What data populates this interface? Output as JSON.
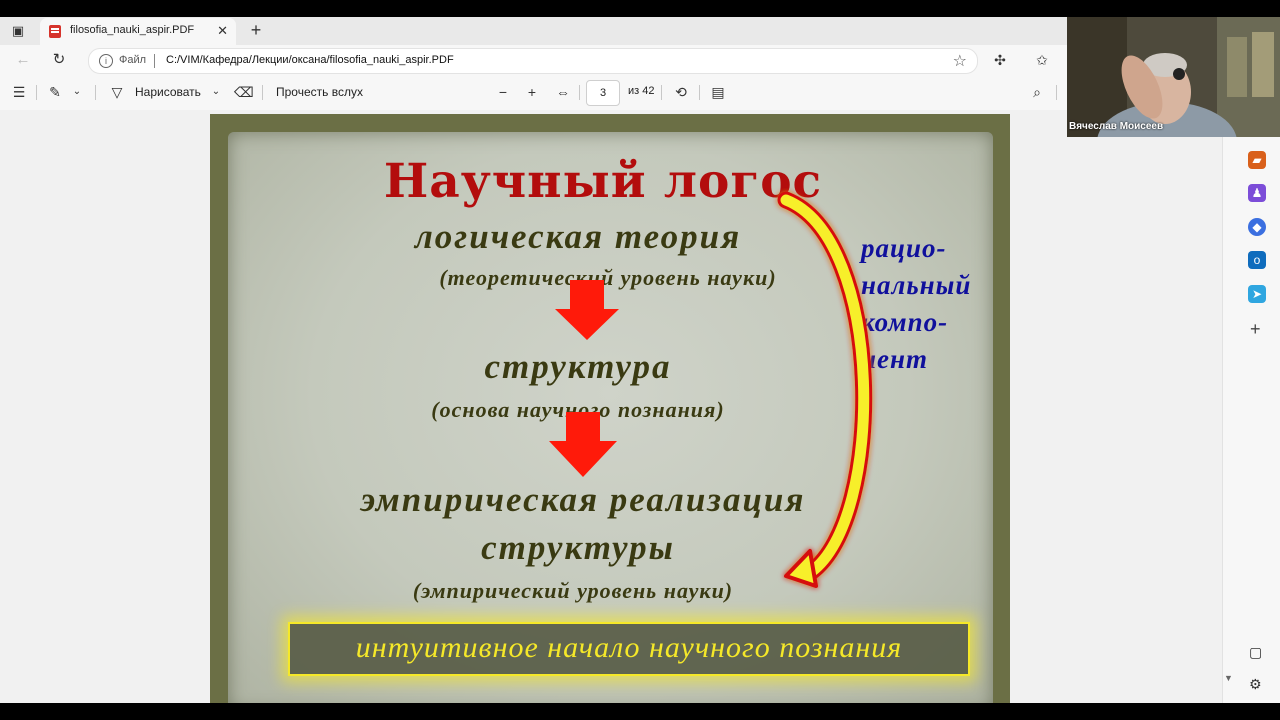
{
  "tab": {
    "title": "filosofia_nauki_aspir.PDF"
  },
  "address": {
    "file_label": "Файл",
    "url": "C:/VIM/Кафедра/Лекции/оксана/filosofia_nauki_aspir.PDF"
  },
  "pdf_toolbar": {
    "draw_label": "Нарисовать",
    "read_aloud_label": "Прочесть вслух",
    "page_current": "3",
    "page_total": "из 42"
  },
  "slide": {
    "title": "Научный логос",
    "level1": "логическая теория",
    "level1_sub": "(теоретический уровень науки)",
    "level2": "структура",
    "level2_sub": "(основа научного познания)",
    "level3_line1": "эмпирическая реализация",
    "level3_line2": "структуры",
    "level3_sub": "(эмпирический уровень науки)",
    "side_line1": "рацио-",
    "side_line2": "нальный",
    "side_line3": "компо-",
    "side_line4": "нент",
    "bottom_box": "интуитивное начало научного познания",
    "colors": {
      "title": "#b30d0d",
      "main_text": "#3a3a12",
      "side_text": "#10109c",
      "highlight": "#f5e829",
      "arrow_red": "#ff1a0a"
    }
  },
  "webcam": {
    "participant_name": "Вячеслав Моисеев"
  },
  "icons": {
    "tab_actions": "tab-actions-icon",
    "back": "back-arrow-icon",
    "refresh": "refresh-icon",
    "favorites": "star-icon",
    "extensions": "puzzle-icon",
    "collections": "favorites-list-icon",
    "toc": "contents-icon",
    "highlight": "highlighter-icon",
    "draw": "pen-icon",
    "erase": "eraser-icon",
    "zoom_out": "minus-icon",
    "zoom_in": "plus-icon",
    "fit": "fit-width-icon",
    "rotate": "rotate-icon",
    "page_view": "page-view-icon",
    "search": "search-icon"
  }
}
